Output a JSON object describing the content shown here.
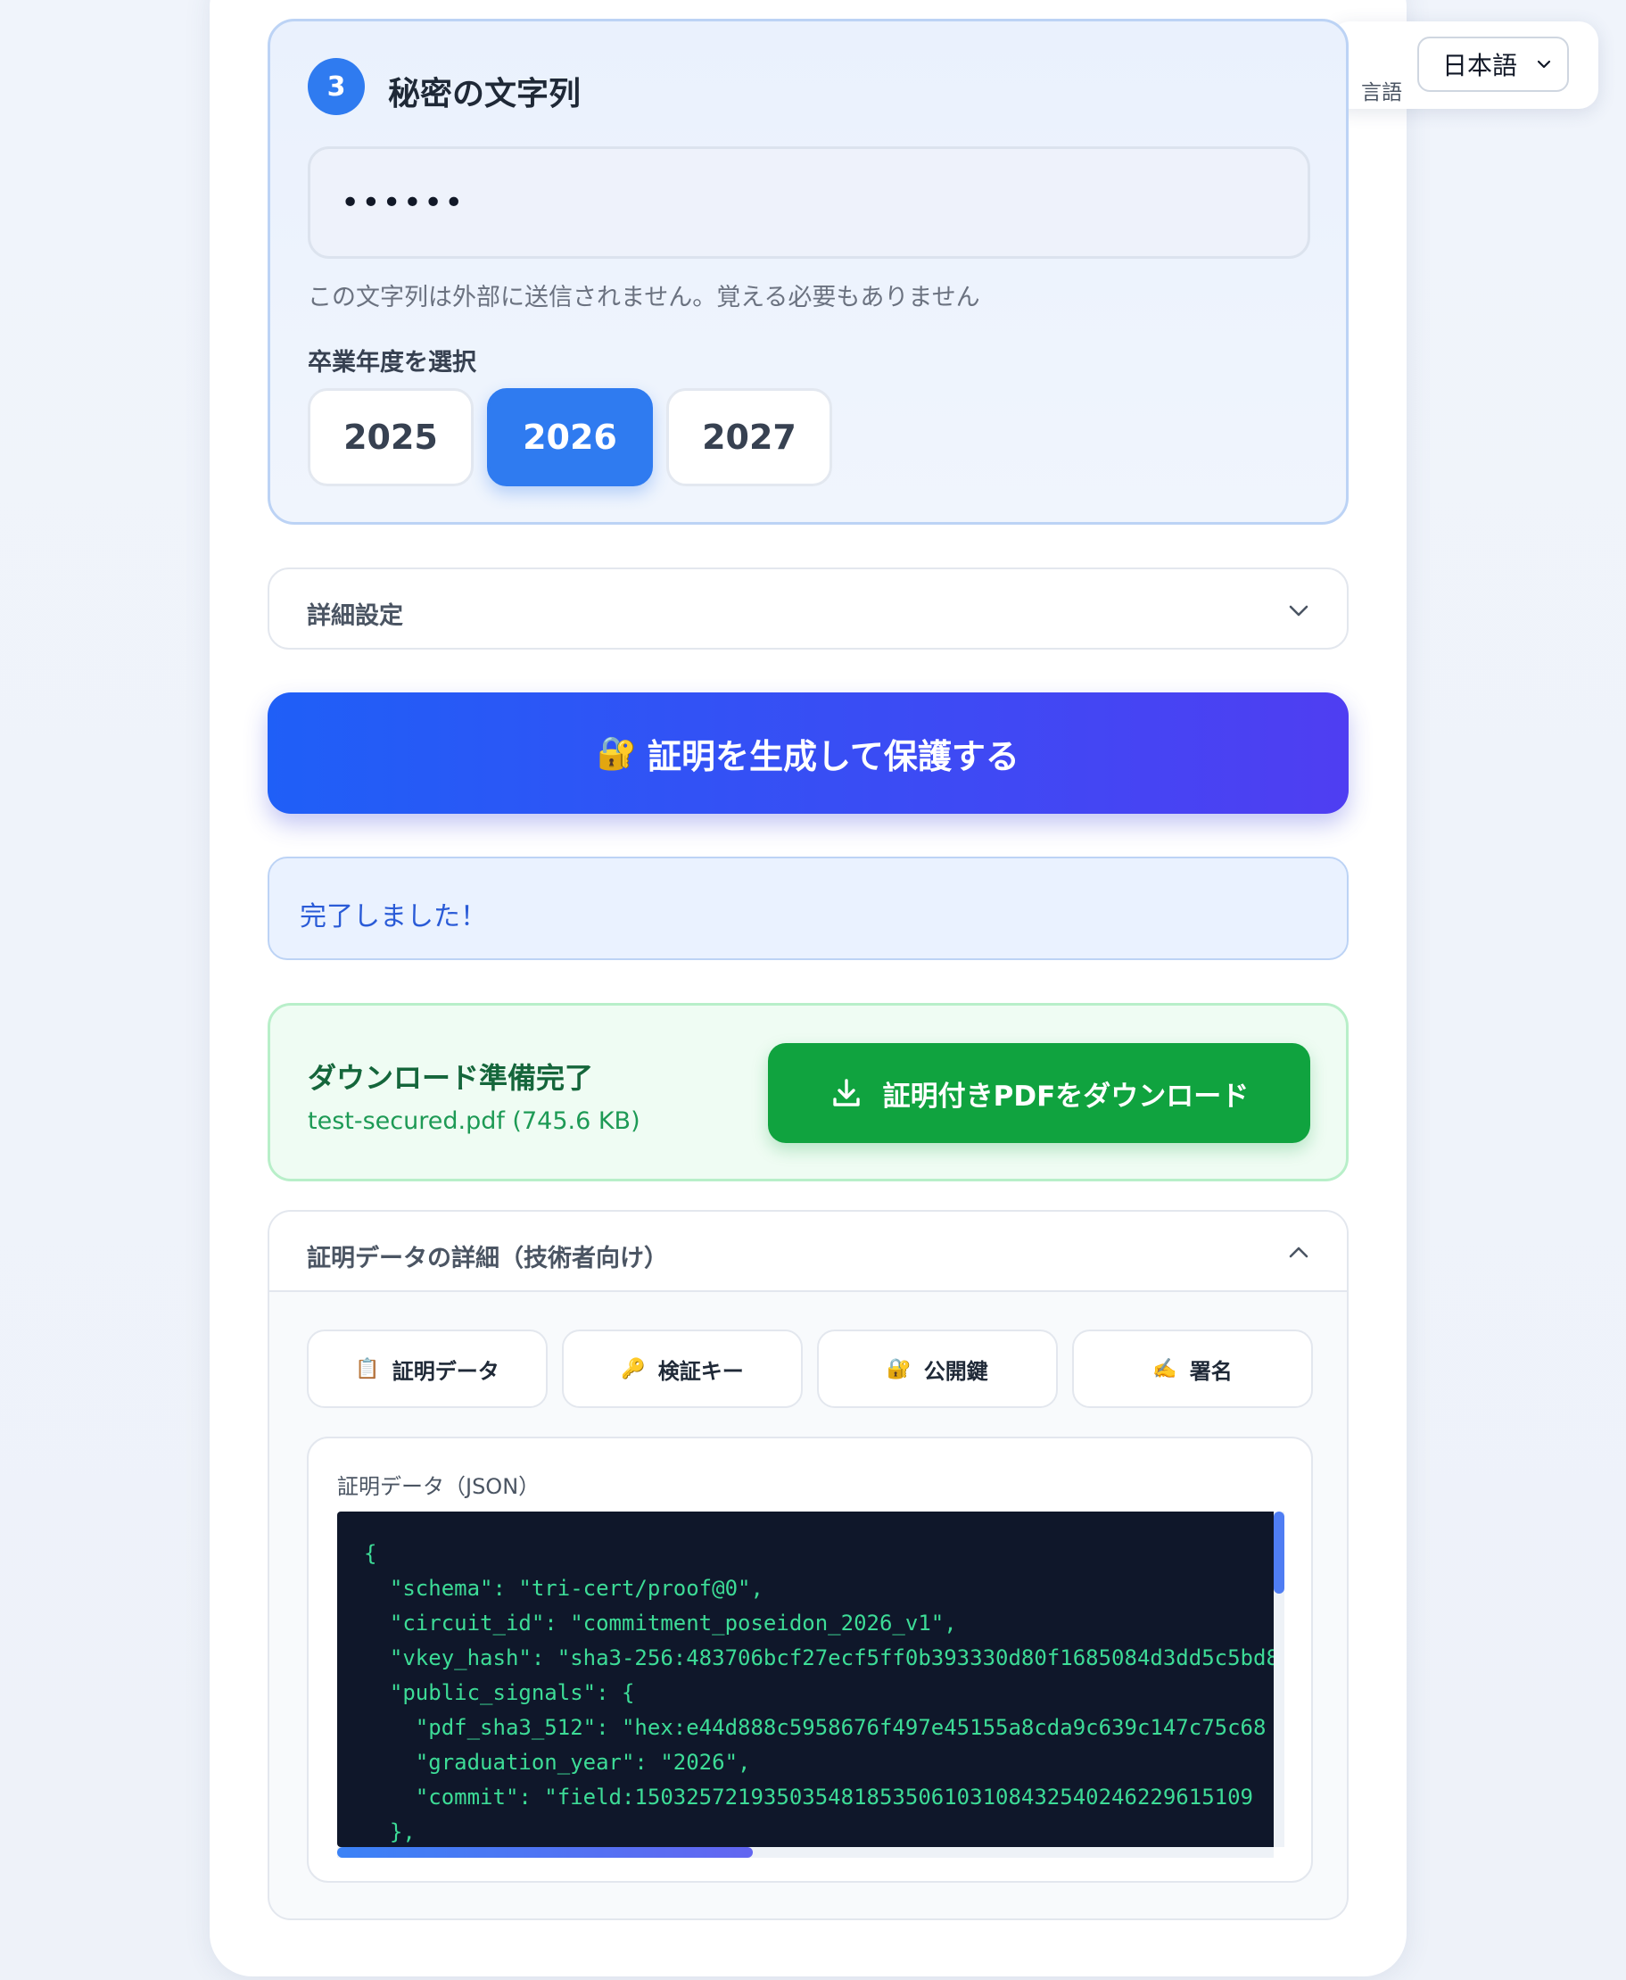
{
  "language": {
    "label": "言語",
    "selected": "日本語"
  },
  "step": {
    "number": "3",
    "title": "秘密の文字列",
    "secret_value": "••••••",
    "hint": "この文字列は外部に送信されません。覚える必要もありません",
    "year_label": "卒業年度を選択",
    "years": [
      "2025",
      "2026",
      "2027"
    ],
    "selected_year": "2026"
  },
  "advanced": {
    "label": "詳細設定"
  },
  "generate_button": {
    "icon": "🔐",
    "label": "証明を生成して保護する"
  },
  "status": {
    "message": "完了しました！"
  },
  "download": {
    "title": "ダウンロード準備完了",
    "file": "test-secured.pdf (745.6 KB)",
    "button_label": "証明付きPDFをダウンロード"
  },
  "proof_details": {
    "label": "証明データの詳細（技術者向け）",
    "tabs": [
      {
        "icon": "📋",
        "label": "証明データ"
      },
      {
        "icon": "🔑",
        "label": "検証キー"
      },
      {
        "icon": "🔐",
        "label": "公開鍵"
      },
      {
        "icon": "✍️",
        "label": "署名"
      }
    ],
    "json_label": "証明データ（JSON）",
    "json_lines": [
      "{",
      "  \"schema\": \"tri-cert/proof@0\",",
      "  \"circuit_id\": \"commitment_poseidon_2026_v1\",",
      "  \"vkey_hash\": \"sha3-256:483706bcf27ecf5ff0b393330d80f1685084d3dd5c5bd8",
      "  \"public_signals\": {",
      "    \"pdf_sha3_512\": \"hex:e44d888c5958676f497e45155a8cda9c639c147c75c68",
      "    \"graduation_year\": \"2026\",",
      "    \"commit\": \"field:150325721935035481853506103108432540246229615109",
      "  },"
    ]
  },
  "colors": {
    "accent": "#2f7bf0",
    "gradient_start": "#1f5ff7",
    "gradient_end": "#4f3ef2",
    "success": "#10a33f",
    "code_bg": "#0f172a",
    "code_text": "#3ddc97"
  }
}
